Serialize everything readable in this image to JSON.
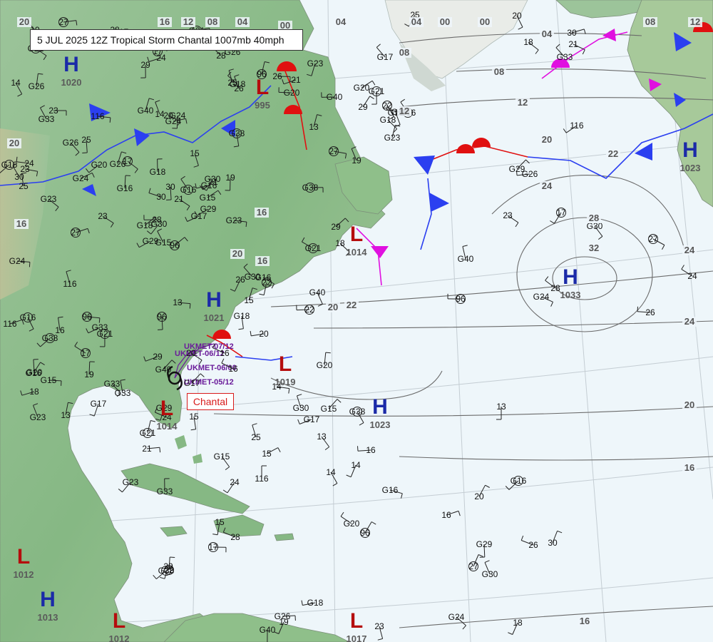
{
  "title": "5 JUL 2025 12Z Tropical Storm Chantal 1007mb 40mph",
  "storm_label": "Chantal",
  "track_labels": [
    "UKMET-07/12",
    "UKMET-06/12",
    "UKMET-06/00",
    "UKMET-05/12"
  ],
  "pressure_centers": [
    {
      "type": "H",
      "pressure": "1020"
    },
    {
      "type": "L",
      "pressure": "995"
    },
    {
      "type": "L",
      "pressure": "1014"
    },
    {
      "type": "H",
      "pressure": "1033"
    },
    {
      "type": "H",
      "pressure": "1023"
    },
    {
      "type": "H",
      "pressure": "1021"
    },
    {
      "type": "L",
      "pressure": "1019"
    },
    {
      "type": "L",
      "pressure": "1014"
    },
    {
      "type": "H",
      "pressure": "1023"
    },
    {
      "type": "L",
      "pressure": "1012"
    },
    {
      "type": "H",
      "pressure": "1013"
    },
    {
      "type": "L",
      "pressure": "1012"
    },
    {
      "type": "L",
      "pressure": "1017"
    }
  ],
  "isobar_labels": [
    "20",
    "16",
    "12",
    "08",
    "04",
    "00",
    "04",
    "00",
    "00",
    "04",
    "08",
    "04",
    "08",
    "12",
    "12",
    "08",
    "12",
    "20",
    "24",
    "28",
    "32",
    "24",
    "24",
    "20",
    "20",
    "16",
    "16",
    "16",
    "20",
    "16",
    "22",
    "22",
    "20",
    "16"
  ],
  "station_values": [
    "96",
    "G33",
    "G30",
    "G20",
    "G16",
    "G21",
    "G26",
    "G24",
    "G18",
    "G17",
    "G16",
    "G15",
    "G23",
    "G40",
    "G29",
    "G38",
    "13",
    "14",
    "15",
    "16",
    "17",
    "18",
    "19",
    "20",
    "21",
    "22",
    "23",
    "24",
    "25",
    "26",
    "27",
    "28",
    "29",
    "30",
    "116"
  ],
  "colors": {
    "ocean": "#eef6fa",
    "land": "#8fbf8a",
    "high": "#1b2aa8",
    "low": "#b50d0d",
    "cold_front": "#2b3ff0",
    "warm_front": "#e01010",
    "occluded_front": "#e010e0",
    "isobar": "#555555",
    "track": "#6a1b9a"
  }
}
